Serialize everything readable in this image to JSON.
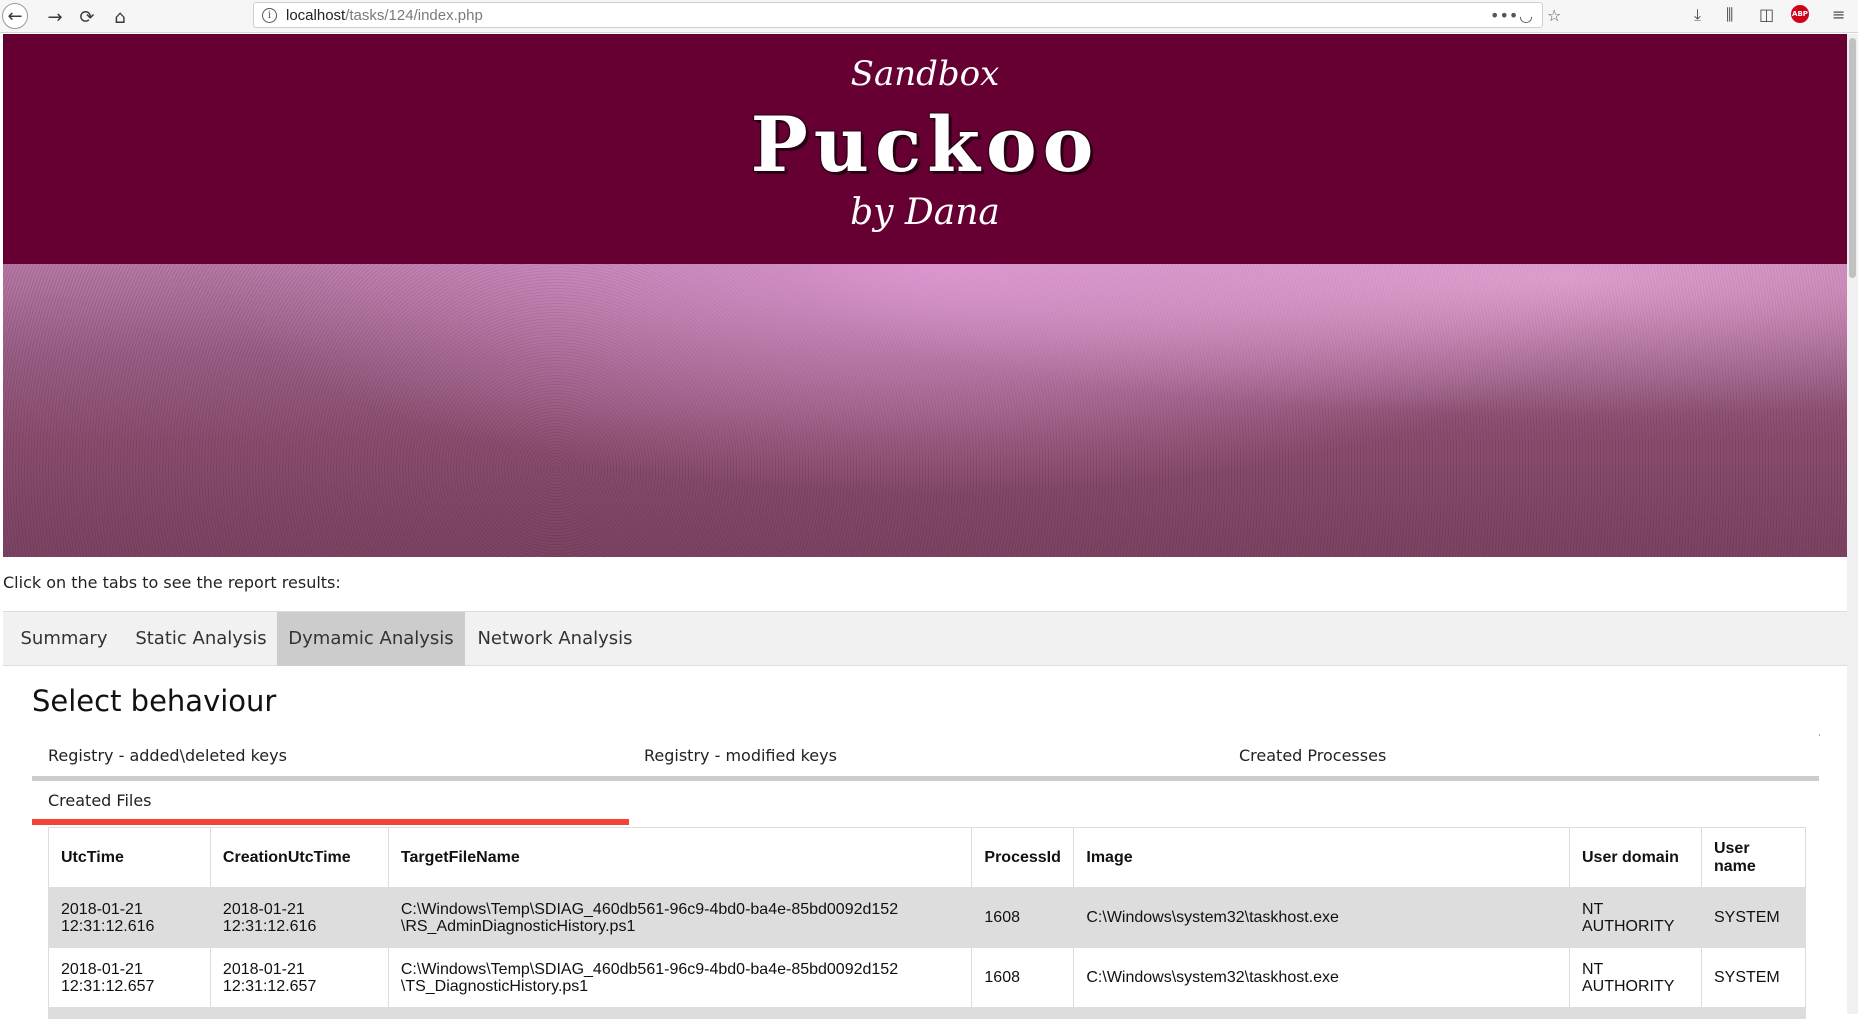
{
  "browser": {
    "url_host": "localhost",
    "url_path": "/tasks/124/index.php"
  },
  "banner": {
    "line1": "Sandbox",
    "line2": "Puckoo",
    "line3": "by Dana"
  },
  "intro_text": "Click on the tabs to see the report results:",
  "tabs": [
    {
      "label": "Summary",
      "active": false
    },
    {
      "label": "Static Analysis",
      "active": false
    },
    {
      "label": "Dymamic Analysis",
      "active": true
    },
    {
      "label": "Network Analysis",
      "active": false
    }
  ],
  "section_title": "Select behaviour",
  "behaviours": [
    {
      "label": "Registry - added\\deleted keys",
      "active": false
    },
    {
      "label": "Registry - modified keys",
      "active": false
    },
    {
      "label": "Created Processes",
      "active": false
    },
    {
      "label": "Created Files",
      "active": true
    }
  ],
  "table": {
    "headers": [
      "UtcTime",
      "CreationUtcTime",
      "TargetFileName",
      "ProcessId",
      "Image",
      "User domain",
      "User name"
    ],
    "rows": [
      {
        "utc_l1": "2018-01-21",
        "utc_l2": "12:31:12.616",
        "creation_l1": "2018-01-21",
        "creation_l2": "12:31:12.616",
        "target_l1": "C:\\Windows\\Temp\\SDIAG_460db561-96c9-4bd0-ba4e-85bd0092d152",
        "target_l2": "\\RS_AdminDiagnosticHistory.ps1",
        "pid": "1608",
        "image": "C:\\Windows\\system32\\taskhost.exe",
        "domain_l1": "NT",
        "domain_l2": "AUTHORITY",
        "user": "SYSTEM"
      },
      {
        "utc_l1": "2018-01-21",
        "utc_l2": "12:31:12.657",
        "creation_l1": "2018-01-21",
        "creation_l2": "12:31:12.657",
        "target_l1": "C:\\Windows\\Temp\\SDIAG_460db561-96c9-4bd0-ba4e-85bd0092d152",
        "target_l2": "\\TS_DiagnosticHistory.ps1",
        "pid": "1608",
        "image": "C:\\Windows\\system32\\taskhost.exe",
        "domain_l1": "NT",
        "domain_l2": "AUTHORITY",
        "user": "SYSTEM"
      }
    ]
  },
  "colors": {
    "banner": "#660033",
    "active_tab": "#cccccc",
    "active_behaviour_underline": "#f44336"
  },
  "icons": [
    "back-icon",
    "forward-icon",
    "reload-icon",
    "home-icon",
    "info-icon",
    "more-icon",
    "pocket-icon",
    "bookmark-star-icon",
    "download-icon",
    "library-icon",
    "sidebar-icon",
    "adblock-icon",
    "menu-icon"
  ]
}
